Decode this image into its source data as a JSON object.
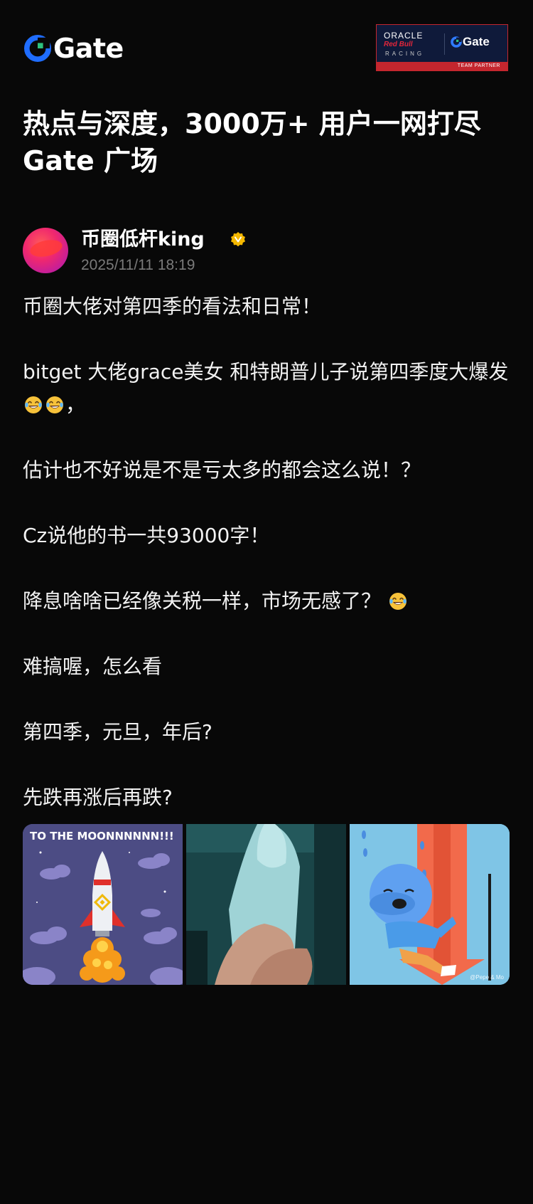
{
  "brand": {
    "logo_text": "Gate",
    "accent": "#1f6dff",
    "partner_badge": {
      "oracle": "ORACLE",
      "redbull": "Red Bull",
      "racing": "RACING",
      "gate": "Gate",
      "team_partner": "TEAM PARTNER"
    }
  },
  "headline": {
    "line1": "热点与深度，3000万+ 用户一网打尽",
    "line2": "Gate 广场"
  },
  "post": {
    "author": "币圈低杆king",
    "timestamp": "2025/11/11 18:19",
    "verified_icon": "verified-badge-icon",
    "paragraphs": [
      "币圈大佬对第四季的看法和日常！",
      "bitget 大佬grace美女 和特朗普儿子说第四季度大爆发",
      "估计也不好说是不是亏太多的都会这么说！？",
      "Cz说他的书一共93000字！",
      "降息啥啥已经像关税一样，市场无感了？",
      "难搞喔，怎么看",
      "第四季，元旦，年后?",
      "先跌再涨后再跌?"
    ],
    "para2_tail": "，",
    "emoji_icon": "laugh-cry-emoji-icon"
  },
  "gallery": {
    "image1_text": "TO THE MOONNNNNN!!!",
    "image3_watermark": "@Pepe & Mo"
  }
}
